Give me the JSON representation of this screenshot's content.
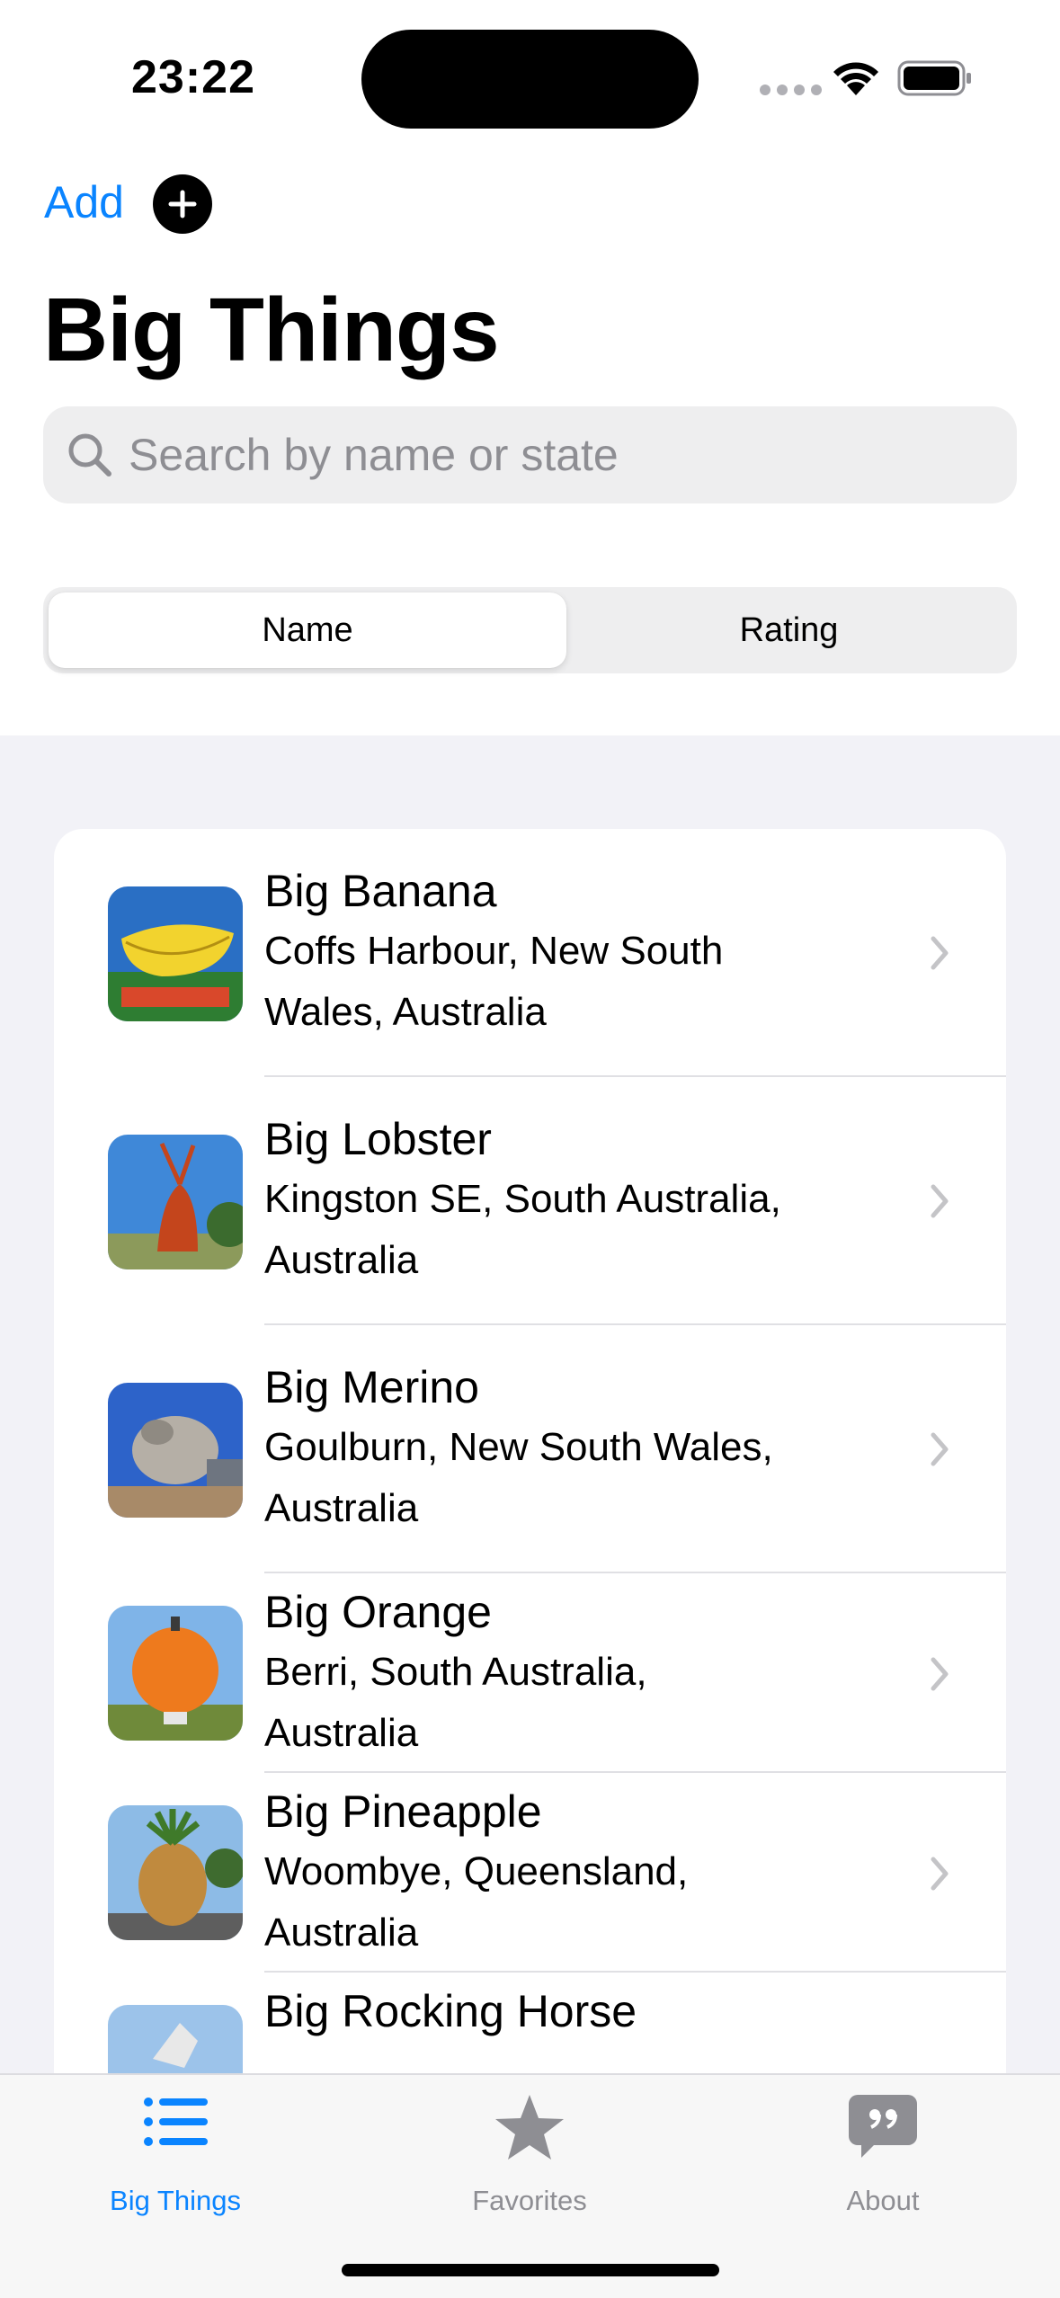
{
  "status_bar": {
    "time": "23:22"
  },
  "nav": {
    "add_label": "Add",
    "title": "Big Things"
  },
  "search": {
    "placeholder": "Search by name or state",
    "value": ""
  },
  "segments": [
    "Name",
    "Rating"
  ],
  "selected_segment": "Name",
  "list": [
    {
      "title": "Big Banana",
      "subtitle": "Coffs Harbour, New South Wales, Australia"
    },
    {
      "title": "Big Lobster",
      "subtitle": "Kingston SE, South Australia, Australia"
    },
    {
      "title": "Big Merino",
      "subtitle": "Goulburn, New South Wales, Australia"
    },
    {
      "title": "Big Orange",
      "subtitle": "Berri, South Australia, Australia"
    },
    {
      "title": "Big Pineapple",
      "subtitle": "Woombye, Queensland, Australia"
    },
    {
      "title": "Big Rocking Horse",
      "subtitle": ""
    }
  ],
  "tabs": [
    {
      "label": "Big Things",
      "icon": "list-bullet-icon",
      "active": true
    },
    {
      "label": "Favorites",
      "icon": "star-icon",
      "active": false
    },
    {
      "label": "About",
      "icon": "quote-bubble-icon",
      "active": false
    }
  ],
  "colors": {
    "accent": "#0A84FF",
    "inactive": "#8E8E93",
    "background": "#F2F2F7"
  }
}
